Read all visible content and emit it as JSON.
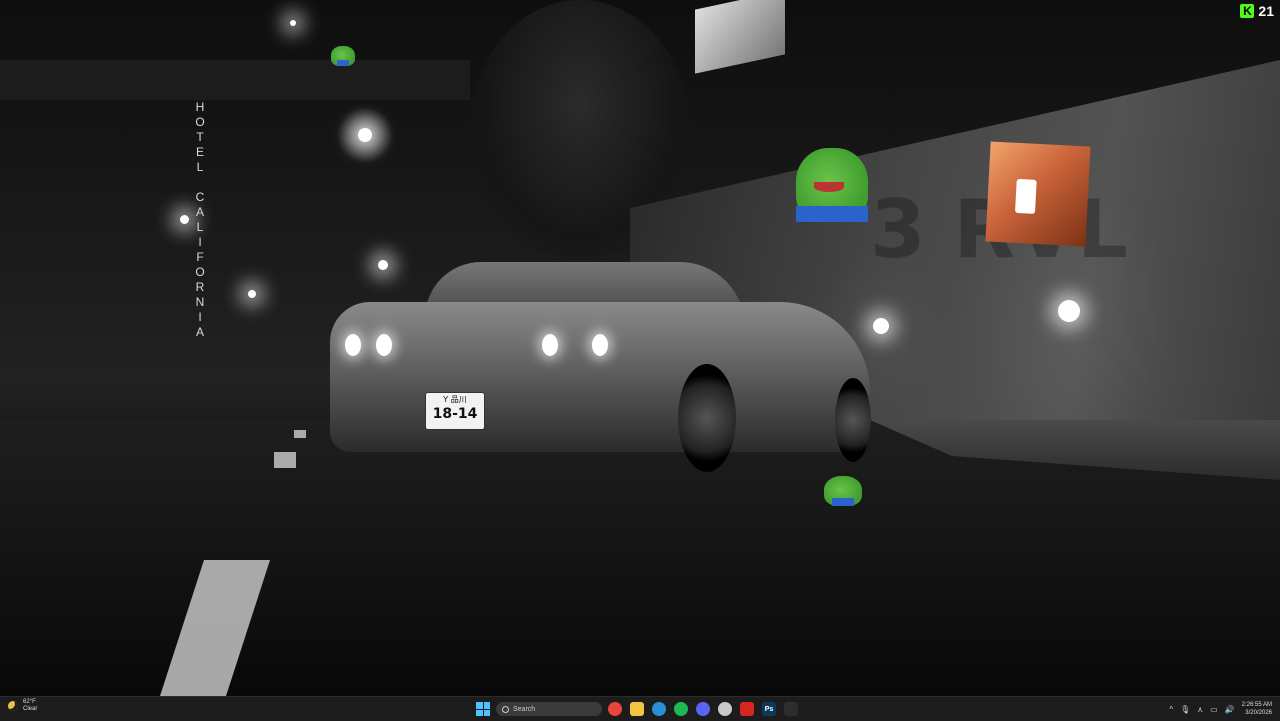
{
  "desktop": {
    "hotel_sign": "HOTEL CALIFORNIA",
    "plate_top": "Y 品川",
    "plate_number": "18-14",
    "overlay_counter": {
      "logo": "K",
      "value": "21"
    }
  },
  "taskbar": {
    "weather": {
      "temperature": "62°F",
      "condition": "Clear"
    },
    "search_placeholder": "Search",
    "apps": [
      {
        "name": "chrome-icon",
        "label": "",
        "color": "#e8453c"
      },
      {
        "name": "file-explorer-icon",
        "label": "",
        "color": "#f4c542"
      },
      {
        "name": "edge-icon",
        "label": "",
        "color": "#2b8fd6"
      },
      {
        "name": "spotify-icon",
        "label": "",
        "color": "#1db954"
      },
      {
        "name": "discord-icon",
        "label": "",
        "color": "#5865f2"
      },
      {
        "name": "davinci-icon",
        "label": "",
        "color": "#c9c9c9"
      },
      {
        "name": "acrobat-icon",
        "label": "",
        "color": "#d7261e"
      },
      {
        "name": "photoshop-icon",
        "label": "Ps",
        "color": "#0b3b5c"
      },
      {
        "name": "terminal-icon",
        "label": "",
        "color": "#2d2d2d"
      }
    ],
    "tray": {
      "overflow": "^",
      "time": "2:26:55 AM",
      "date": "3/20/2026"
    }
  }
}
